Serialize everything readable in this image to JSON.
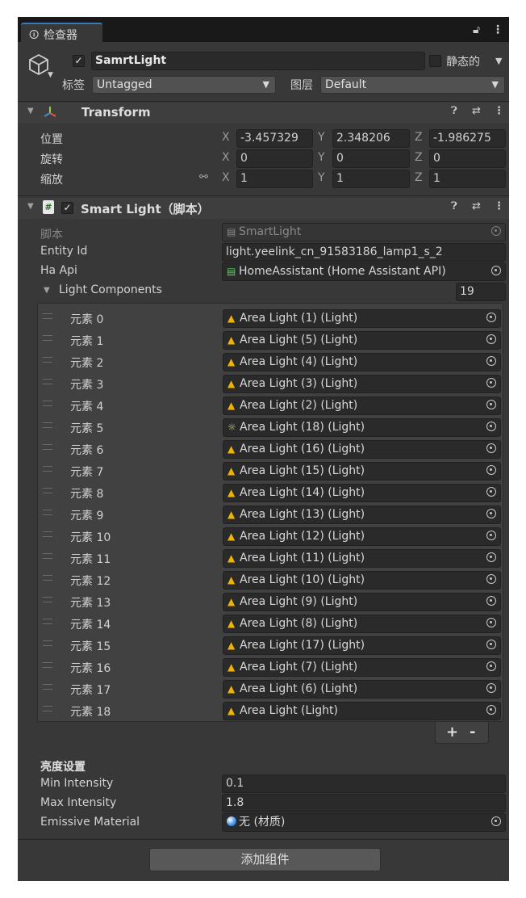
{
  "tab": {
    "icon": "info-icon",
    "label": "检查器"
  },
  "header": {
    "object_name": "SamrtLight",
    "static_label": "静态的",
    "tag_label": "标签",
    "tag_value": "Untagged",
    "layer_label": "图层",
    "layer_value": "Default"
  },
  "transform": {
    "title": "Transform",
    "position_label": "位置",
    "rotation_label": "旋转",
    "scale_label": "缩放",
    "axis_x": "X",
    "axis_y": "Y",
    "axis_z": "Z",
    "position": {
      "x": "-3.457329",
      "y": "2.348206",
      "z": "-1.986275"
    },
    "rotation": {
      "x": "0",
      "y": "0",
      "z": "0"
    },
    "scale": {
      "x": "1",
      "y": "1",
      "z": "1"
    }
  },
  "smart_light": {
    "title": "Smart Light（脚本）",
    "script_label": "脚本",
    "script_value": "SmartLight",
    "entity_label": "Entity Id",
    "entity_value": "light.yeelink_cn_91583186_lamp1_s_2",
    "ha_label": "Ha Api",
    "ha_value": "HomeAssistant (Home Assistant API)",
    "components_label": "Light Components",
    "components_count": "19",
    "components": [
      {
        "label": "元素 0",
        "value": "Area Light (1) (Light)",
        "icon": "lamp"
      },
      {
        "label": "元素 1",
        "value": "Area Light (5) (Light)",
        "icon": "lamp"
      },
      {
        "label": "元素 2",
        "value": "Area Light (4) (Light)",
        "icon": "lamp"
      },
      {
        "label": "元素 3",
        "value": "Area Light (3) (Light)",
        "icon": "lamp"
      },
      {
        "label": "元素 4",
        "value": "Area Light (2) (Light)",
        "icon": "lamp"
      },
      {
        "label": "元素 5",
        "value": "Area Light (18) (Light)",
        "icon": "sun"
      },
      {
        "label": "元素 6",
        "value": "Area Light (16) (Light)",
        "icon": "lamp"
      },
      {
        "label": "元素 7",
        "value": "Area Light (15) (Light)",
        "icon": "lamp"
      },
      {
        "label": "元素 8",
        "value": "Area Light (14) (Light)",
        "icon": "lamp"
      },
      {
        "label": "元素 9",
        "value": "Area Light (13) (Light)",
        "icon": "lamp"
      },
      {
        "label": "元素 10",
        "value": "Area Light (12) (Light)",
        "icon": "lamp"
      },
      {
        "label": "元素 11",
        "value": "Area Light (11) (Light)",
        "icon": "lamp"
      },
      {
        "label": "元素 12",
        "value": "Area Light (10) (Light)",
        "icon": "lamp"
      },
      {
        "label": "元素 13",
        "value": "Area Light (9) (Light)",
        "icon": "lamp"
      },
      {
        "label": "元素 14",
        "value": "Area Light (8) (Light)",
        "icon": "lamp"
      },
      {
        "label": "元素 15",
        "value": "Area Light (17) (Light)",
        "icon": "lamp"
      },
      {
        "label": "元素 16",
        "value": "Area Light (7) (Light)",
        "icon": "lamp"
      },
      {
        "label": "元素 17",
        "value": "Area Light (6) (Light)",
        "icon": "lamp"
      },
      {
        "label": "元素 18",
        "value": "Area Light (Light)",
        "icon": "lamp"
      }
    ],
    "plus": "+",
    "minus": "-",
    "brightness_header": "亮度设置",
    "min_label": "Min Intensity",
    "min_value": "0.1",
    "max_label": "Max Intensity",
    "max_value": "1.8",
    "emissive_label": "Emissive Material",
    "emissive_value": "无 (材质)"
  },
  "add_component": "添加组件"
}
